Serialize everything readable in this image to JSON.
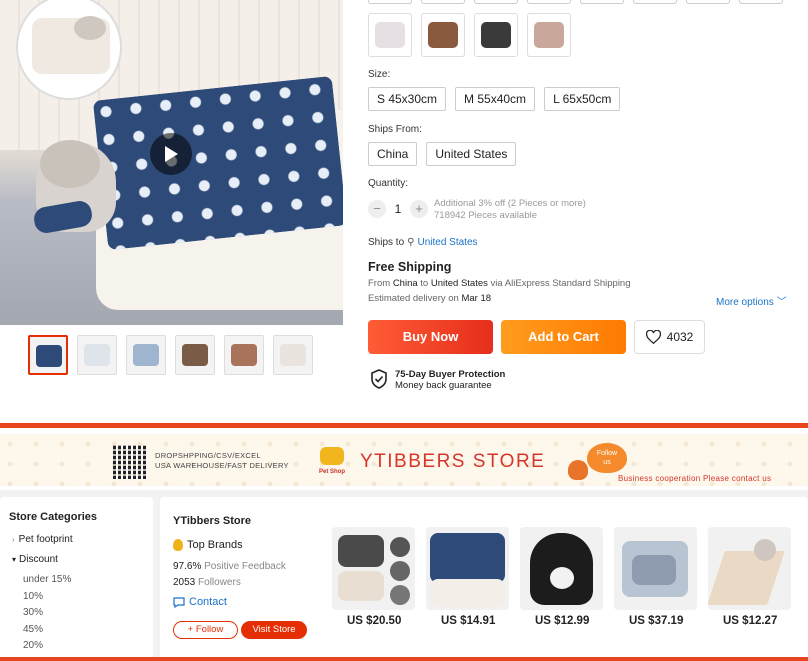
{
  "product": {
    "thumbnail_count": 6,
    "size_label": "Size:",
    "sizes": [
      "S 45x30cm",
      "M 55x40cm",
      "L 65x50cm"
    ],
    "ships_from_label": "Ships From:",
    "ships_from": [
      "China",
      "United States"
    ],
    "quantity_label": "Quantity:",
    "quantity_value": "1",
    "quantity_decrease": "−",
    "quantity_increase": "+",
    "discount_note": "Additional 3% off (2 Pieces or more)",
    "pieces_available": "718942 Pieces available",
    "ships_to_label": "Ships to",
    "ships_to_country": "United States",
    "free_shipping": "Free Shipping",
    "from_prefix": "From",
    "from_origin": "China",
    "from_to": "to",
    "from_dest": "United States",
    "from_suffix": "via AliExpress Standard Shipping",
    "delivery_prefix": "Estimated delivery on",
    "delivery_date": "Mar 18",
    "more_options": "More options",
    "buy_now": "Buy Now",
    "add_to_cart": "Add to Cart",
    "wishlist_count": "4032",
    "protection_title": "75-Day Buyer Protection",
    "protection_sub": "Money back guarantee"
  },
  "banner": {
    "dropship_line1": "DROPSHPPING/CSV/EXCEL",
    "dropship_line2": "USA WAREHOUSE/FAST DELIVERY",
    "logo_text": "Pet Shop",
    "store_title": "YTIBBERS STORE",
    "follow_badge_1": "Follow",
    "follow_badge_2": "us",
    "cooperation": "Business cooperation Please contact us"
  },
  "categories": {
    "title": "Store Categories",
    "items": [
      {
        "label": "Pet footprint",
        "marker": "›"
      },
      {
        "label": "Discount",
        "marker": "▾"
      }
    ],
    "sub_items": [
      "under 15%",
      "10%",
      "30%",
      "45%",
      "20%"
    ]
  },
  "store": {
    "name": "YTibbers Store",
    "badge": "Top Brands",
    "feedback_value": "97.6%",
    "feedback_label": "Positive Feedback",
    "followers_value": "2053",
    "followers_label": "Followers",
    "contact": "Contact",
    "follow_button": "+ Follow",
    "visit_button": "Visit Store"
  },
  "recommended": [
    {
      "price": "US $20.50"
    },
    {
      "price": "US $14.91"
    },
    {
      "price": "US $12.99"
    },
    {
      "price": "US $37.19"
    },
    {
      "price": "US $12.27"
    }
  ],
  "colors": {
    "accent_red": "#e62e04",
    "buy_now": "#e52e1c",
    "add_to_cart": "#ff7a00",
    "link_blue": "#1a73c8"
  }
}
